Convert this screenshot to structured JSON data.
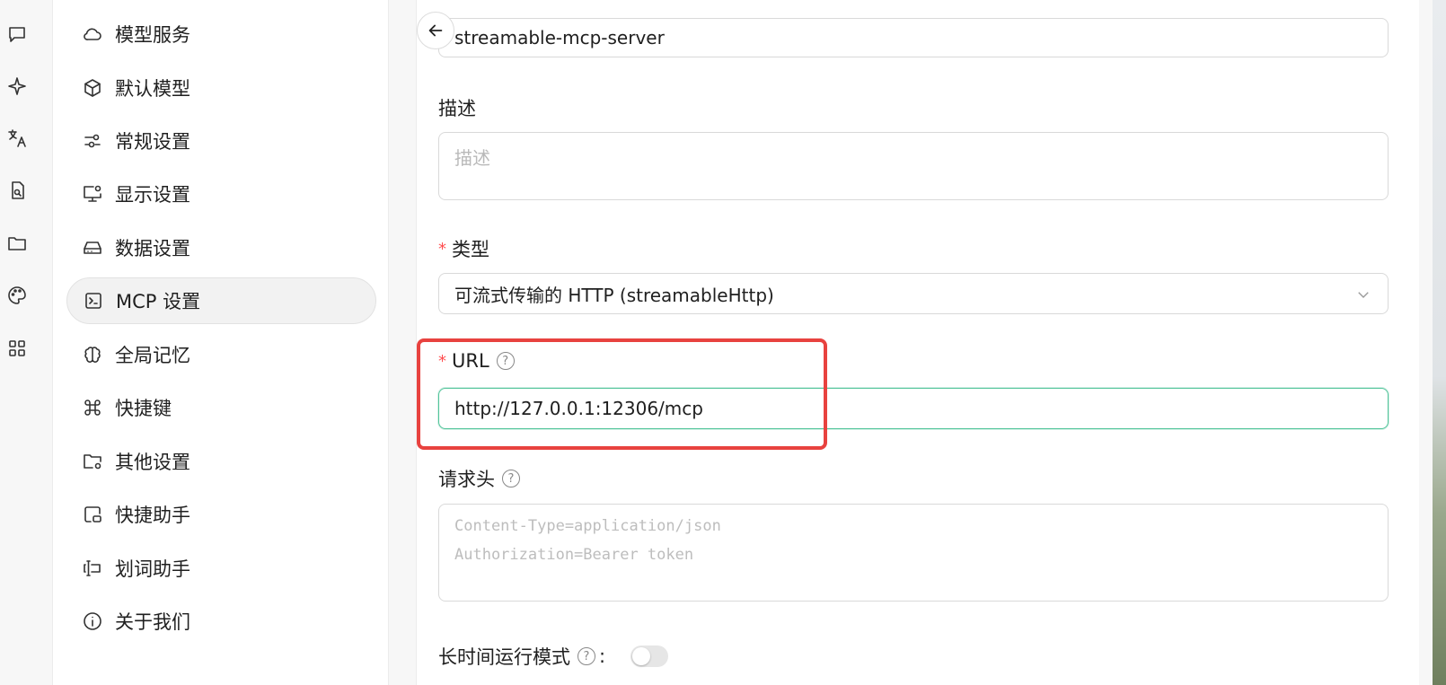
{
  "rail": {
    "icons": [
      "chat-icon",
      "sparkle-icon",
      "translate-icon",
      "document-search-icon",
      "folder-icon",
      "palette-icon",
      "apps-grid-icon"
    ]
  },
  "nav": {
    "items": [
      {
        "label": "模型服务",
        "icon": "cloud-icon",
        "active": false
      },
      {
        "label": "默认模型",
        "icon": "cube-icon",
        "active": false
      },
      {
        "label": "常规设置",
        "icon": "sliders-icon",
        "active": false
      },
      {
        "label": "显示设置",
        "icon": "monitor-gear-icon",
        "active": false
      },
      {
        "label": "数据设置",
        "icon": "hard-drive-icon",
        "active": false
      },
      {
        "label": "MCP 设置",
        "icon": "terminal-icon",
        "active": true
      },
      {
        "label": "全局记忆",
        "icon": "brain-icon",
        "active": false
      },
      {
        "label": "快捷键",
        "icon": "command-icon",
        "active": false
      },
      {
        "label": "其他设置",
        "icon": "folder-gear-icon",
        "active": false
      },
      {
        "label": "快捷助手",
        "icon": "window-assistant-icon",
        "active": false
      },
      {
        "label": "划词助手",
        "icon": "text-cursor-icon",
        "active": false
      },
      {
        "label": "关于我们",
        "icon": "info-icon",
        "active": false
      }
    ]
  },
  "form": {
    "name_value": "streamable-mcp-server",
    "description_label": "描述",
    "description_placeholder": "描述",
    "type_label": "类型",
    "type_value": "可流式传输的 HTTP (streamableHttp)",
    "url_label": "URL",
    "url_value": "http://127.0.0.1:12306/mcp",
    "headers_label": "请求头",
    "headers_placeholder_line1": "Content-Type=application/json",
    "headers_placeholder_line2": "Authorization=Bearer token",
    "long_running_label": "长时间运行模式",
    "long_running_enabled": false,
    "help_glyph": "?",
    "required_mark": "*",
    "colon": ":"
  },
  "colors": {
    "accent": "#52c49a",
    "required": "#ff4d4f",
    "highlight": "#e8423f"
  }
}
